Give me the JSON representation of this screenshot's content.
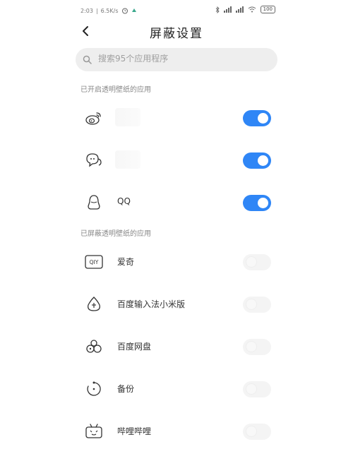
{
  "status_bar": {
    "time": "2:03",
    "net_speed": "6.5K/s",
    "battery": "100"
  },
  "header": {
    "title": "屏蔽设置",
    "back_icon": "chevron-left-icon"
  },
  "search": {
    "placeholder": "搜索95个应用程序"
  },
  "sections": {
    "enabled_label": "已开启透明壁纸的应用",
    "blocked_label": "已屏蔽透明壁纸的应用"
  },
  "enabled_apps": [
    {
      "name": "",
      "icon": "weibo-icon",
      "toggle": "on"
    },
    {
      "name": "",
      "icon": "chat-bubble-icon",
      "toggle": "on"
    },
    {
      "name": "QQ",
      "icon": "qq-icon",
      "toggle": "on"
    }
  ],
  "blocked_apps": [
    {
      "name": "爱奇",
      "icon": "iqiyi-icon",
      "toggle": "off"
    },
    {
      "name": "百度输入法小米版",
      "icon": "baidu-input-icon",
      "toggle": "off"
    },
    {
      "name": "百度网盘",
      "icon": "baidu-netdisk-icon",
      "toggle": "off"
    },
    {
      "name": "备份",
      "icon": "backup-icon",
      "toggle": "off"
    },
    {
      "name": "哔哩哔哩",
      "icon": "bilibili-icon",
      "toggle": "off"
    }
  ],
  "colors": {
    "toggle_on": "#2f86f6",
    "toggle_off": "#f4f4f4"
  }
}
